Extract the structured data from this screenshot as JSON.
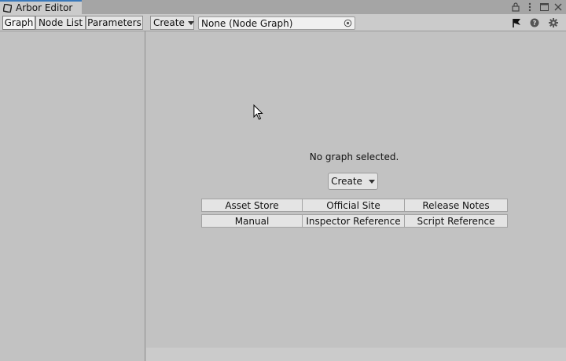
{
  "window": {
    "title": "Arbor Editor"
  },
  "toolbar": {
    "tabs": [
      {
        "label": "Graph"
      },
      {
        "label": "Node List"
      },
      {
        "label": "Parameters"
      }
    ],
    "create_label": "Create",
    "object_field_value": "None (Node Graph)"
  },
  "main": {
    "empty_message": "No graph selected.",
    "create_label": "Create",
    "links": [
      {
        "label": "Asset Store"
      },
      {
        "label": "Official Site"
      },
      {
        "label": "Release Notes"
      },
      {
        "label": "Manual"
      },
      {
        "label": "Inspector Reference"
      },
      {
        "label": "Script Reference"
      }
    ]
  },
  "colors": {
    "accent": "#3a79bb",
    "background": "#c2c2c2"
  }
}
